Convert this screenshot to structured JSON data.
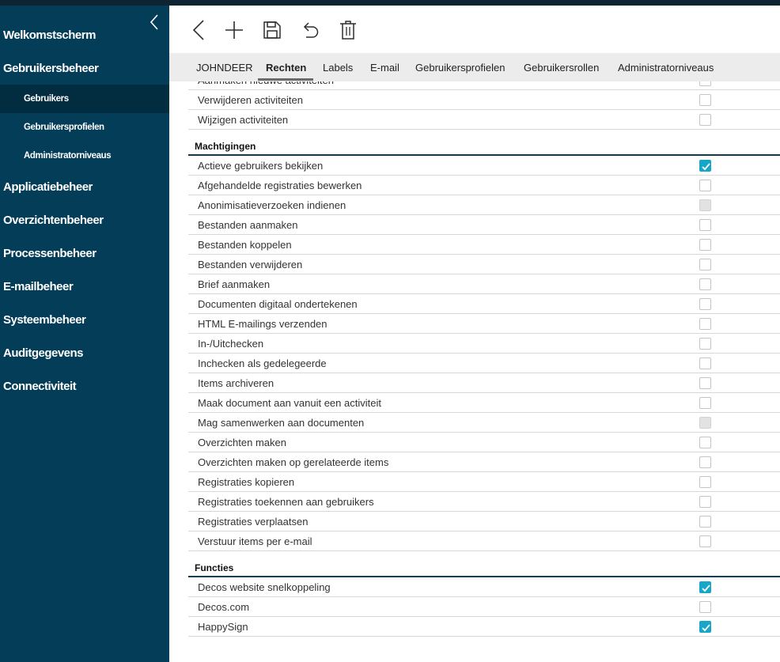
{
  "sidebar": {
    "items": [
      {
        "label": "Welkomstscherm",
        "level": "main",
        "active": false
      },
      {
        "label": "Gebruikersbeheer",
        "level": "main",
        "active": false
      },
      {
        "label": "Gebruikers",
        "level": "sub",
        "active": true
      },
      {
        "label": "Gebruikersprofielen",
        "level": "sub",
        "active": false
      },
      {
        "label": "Administratorniveaus",
        "level": "sub",
        "active": false
      },
      {
        "label": "Applicatiebeheer",
        "level": "main",
        "active": false
      },
      {
        "label": "Overzichtenbeheer",
        "level": "main",
        "active": false
      },
      {
        "label": "Processenbeheer",
        "level": "main",
        "active": false
      },
      {
        "label": "E-mailbeheer",
        "level": "main",
        "active": false
      },
      {
        "label": "Systeembeheer",
        "level": "main",
        "active": false
      },
      {
        "label": "Auditgegevens",
        "level": "main",
        "active": false
      },
      {
        "label": "Connectiviteit",
        "level": "main",
        "active": false
      }
    ]
  },
  "toolbar": {
    "buttons": [
      "back-icon",
      "add-icon",
      "save-icon",
      "undo-icon",
      "delete-icon"
    ]
  },
  "tabs": [
    {
      "label": "JOHNDEER",
      "active": false
    },
    {
      "label": "Rechten",
      "active": true
    },
    {
      "label": "Labels",
      "active": false
    },
    {
      "label": "E-mail",
      "active": false
    },
    {
      "label": "Gebruikersprofielen",
      "active": false
    },
    {
      "label": "Gebruikersrollen",
      "active": false
    },
    {
      "label": "Administratorniveaus",
      "active": false
    }
  ],
  "rights": [
    {
      "type": "row",
      "label": "Aanmaken nieuwe activiteiten",
      "state": "unchecked"
    },
    {
      "type": "row",
      "label": "Verwijderen activiteiten",
      "state": "unchecked"
    },
    {
      "type": "row",
      "label": "Wijzigen activiteiten",
      "state": "unchecked"
    },
    {
      "type": "section",
      "label": "Machtigingen"
    },
    {
      "type": "row",
      "label": "Actieve gebruikers bekijken",
      "state": "checked"
    },
    {
      "type": "row",
      "label": "Afgehandelde registraties bewerken",
      "state": "unchecked"
    },
    {
      "type": "row",
      "label": "Anonimisatieverzoeken indienen",
      "state": "disabled"
    },
    {
      "type": "row",
      "label": "Bestanden aanmaken",
      "state": "unchecked"
    },
    {
      "type": "row",
      "label": "Bestanden koppelen",
      "state": "unchecked"
    },
    {
      "type": "row",
      "label": "Bestanden verwijderen",
      "state": "unchecked"
    },
    {
      "type": "row",
      "label": "Brief aanmaken",
      "state": "unchecked"
    },
    {
      "type": "row",
      "label": "Documenten digitaal ondertekenen",
      "state": "unchecked"
    },
    {
      "type": "row",
      "label": "HTML E-mailings verzenden",
      "state": "unchecked"
    },
    {
      "type": "row",
      "label": "In-/Uitchecken",
      "state": "unchecked"
    },
    {
      "type": "row",
      "label": "Inchecken als gedelegeerde",
      "state": "unchecked"
    },
    {
      "type": "row",
      "label": "Items archiveren",
      "state": "unchecked"
    },
    {
      "type": "row",
      "label": "Maak document aan vanuit een activiteit",
      "state": "unchecked"
    },
    {
      "type": "row",
      "label": "Mag samenwerken aan documenten",
      "state": "disabled"
    },
    {
      "type": "row",
      "label": "Overzichten maken",
      "state": "unchecked"
    },
    {
      "type": "row",
      "label": "Overzichten maken op gerelateerde items",
      "state": "unchecked"
    },
    {
      "type": "row",
      "label": "Registraties kopieren",
      "state": "unchecked"
    },
    {
      "type": "row",
      "label": "Registraties toekennen aan gebruikers",
      "state": "unchecked"
    },
    {
      "type": "row",
      "label": "Registraties verplaatsen",
      "state": "unchecked"
    },
    {
      "type": "row",
      "label": "Verstuur items per e-mail",
      "state": "unchecked"
    },
    {
      "type": "section",
      "label": "Functies"
    },
    {
      "type": "row",
      "label": "Decos website snelkoppeling",
      "state": "checked"
    },
    {
      "type": "row",
      "label": "Decos.com",
      "state": "unchecked"
    },
    {
      "type": "row",
      "label": "HappySign",
      "state": "checked"
    }
  ],
  "colors": {
    "sidebar_bg": "#033d58",
    "sidebar_active": "#022c40",
    "accent_checkbox": "#16a6c8",
    "tabbar_bg": "#ececec"
  }
}
